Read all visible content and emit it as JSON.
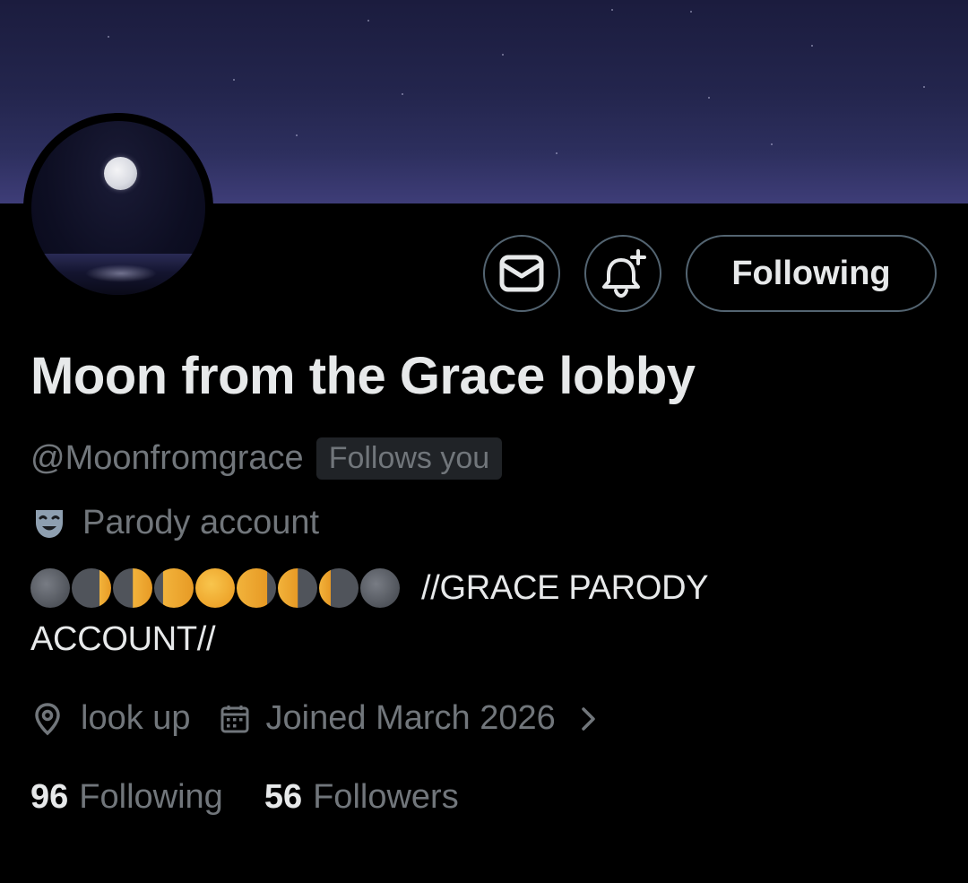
{
  "profile": {
    "display_name": "Moon from the Grace lobby",
    "handle": "@Moonfromgrace",
    "follows_you_badge": "Follows you",
    "parody_label": "Parody account",
    "bio_line1": "//GRACE PARODY",
    "bio_line2": "ACCOUNT//",
    "location": "look up",
    "joined": "Joined March 2026"
  },
  "actions": {
    "message_icon": "envelope-icon",
    "notify_icon": "bell-plus-icon",
    "follow_button_label": "Following"
  },
  "stats": {
    "following_count": "96",
    "following_label": "Following",
    "followers_count": "56",
    "followers_label": "Followers"
  },
  "icons": {
    "parody": "theater-mask-icon",
    "location": "location-pin-icon",
    "calendar": "calendar-icon",
    "chevron": "chevron-right-icon"
  },
  "bio_phase_emojis": [
    "new-moon",
    "waxing-crescent",
    "first-quarter",
    "waxing-gibbous",
    "full-moon",
    "waning-gibbous",
    "last-quarter",
    "waning-crescent",
    "new-moon"
  ],
  "colors": {
    "background": "#000000",
    "text_primary": "#e7e9ea",
    "text_secondary": "#71767b",
    "border": "#536471",
    "badge_bg": "#202327"
  }
}
